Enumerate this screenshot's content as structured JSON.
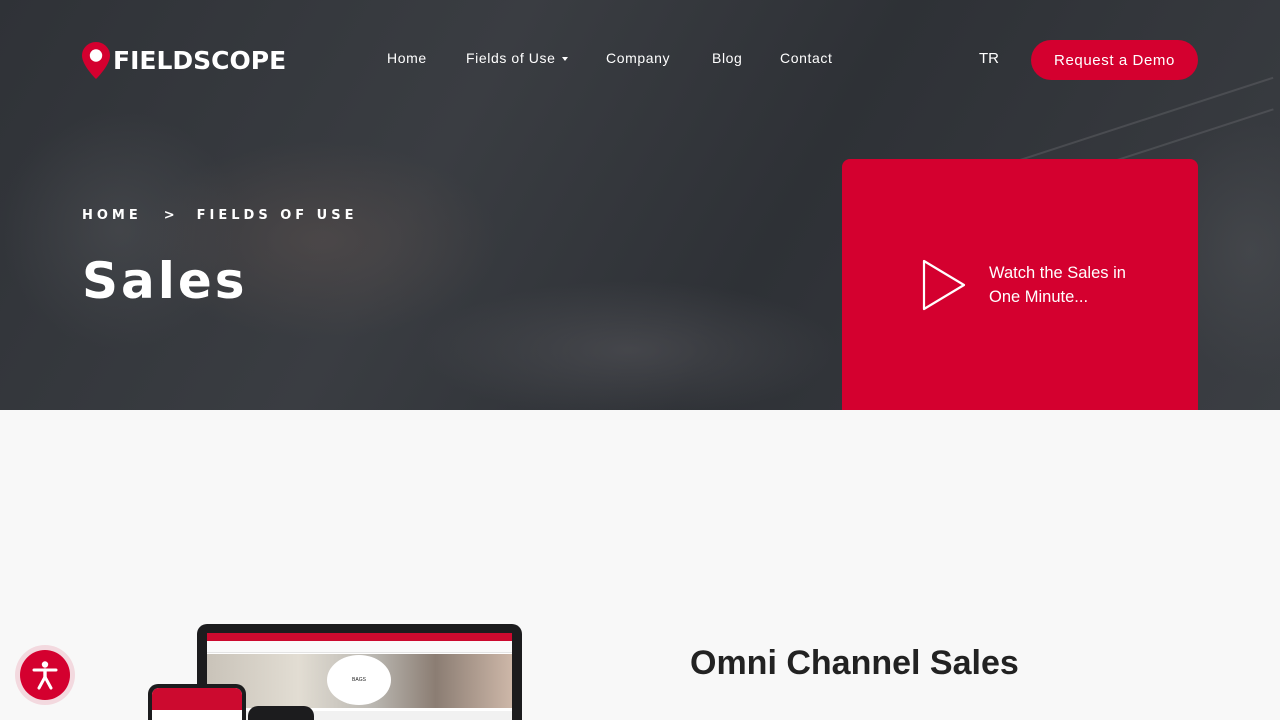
{
  "brand": {
    "name": "FIELDSCOPE",
    "accent": "#d4002f"
  },
  "nav": {
    "items": [
      {
        "label": "Home"
      },
      {
        "label": "Fields of Use",
        "has_dropdown": true
      },
      {
        "label": "Company"
      },
      {
        "label": "Blog"
      },
      {
        "label": "Contact"
      }
    ],
    "language": "TR",
    "cta_label": "Request a Demo"
  },
  "hero": {
    "breadcrumb": {
      "home": "HOME",
      "separator": ">",
      "current": "FIELDS OF USE"
    },
    "title": "Sales"
  },
  "video_card": {
    "text": "Watch the Sales in One Minute...",
    "icon": "play-icon"
  },
  "content": {
    "section_title": "Omni Channel Sales",
    "mockup_banner_label": "BAGS"
  },
  "accessibility": {
    "icon": "accessibility-icon"
  }
}
